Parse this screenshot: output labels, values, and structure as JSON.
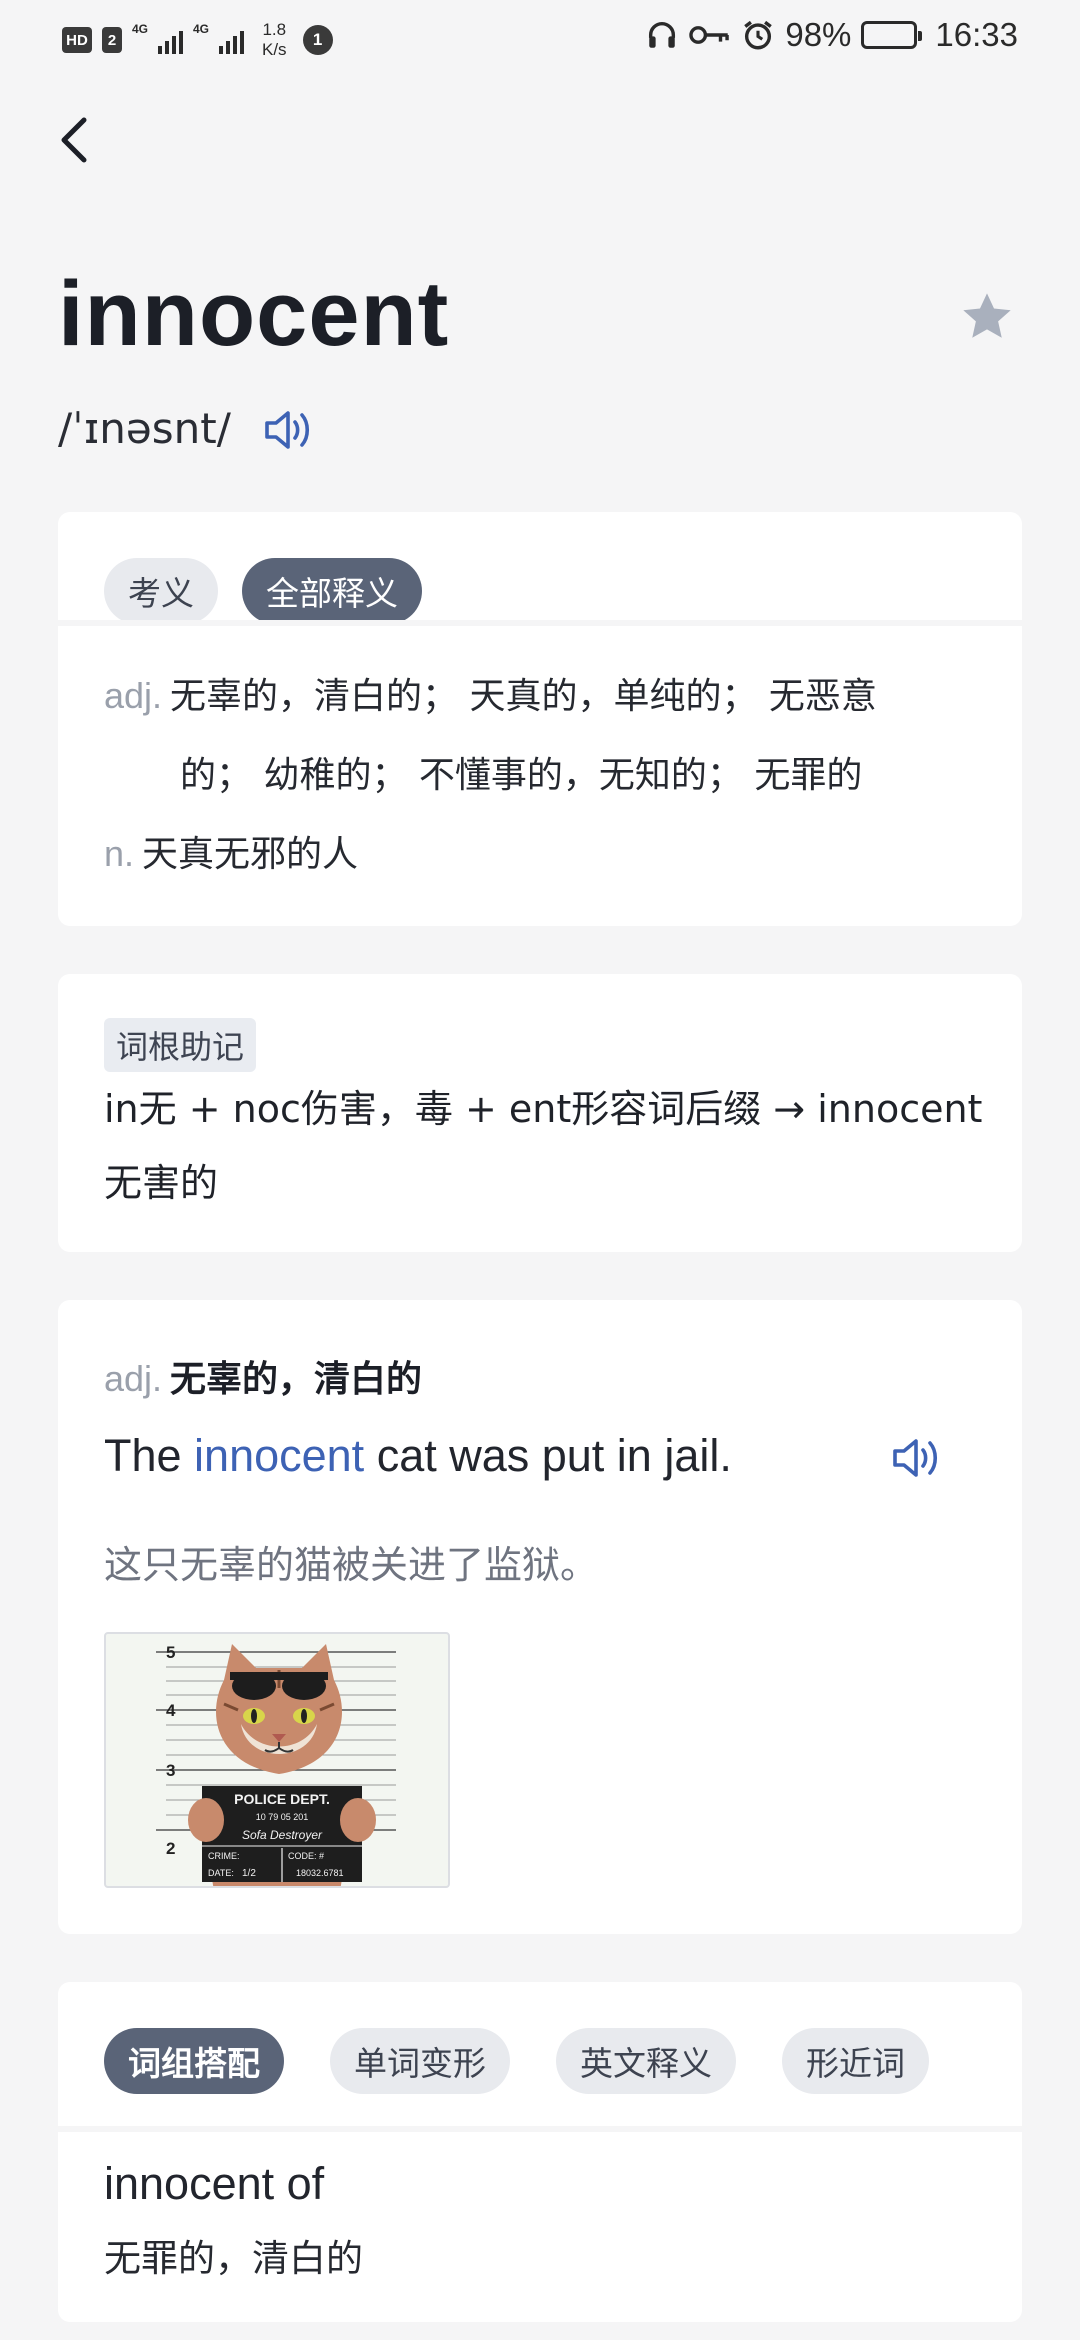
{
  "status_bar": {
    "hd1": "HD",
    "hd2": "2",
    "net1": "4G",
    "net2": "4G",
    "speed_value": "1.8",
    "speed_unit": "K/s",
    "circle_badge": "1",
    "battery": "98%",
    "time": "16:33"
  },
  "word": {
    "headword": "innocent",
    "phonetic": "/ˈɪnəsnt/"
  },
  "definitions": {
    "tabs": [
      "考义",
      "全部释义"
    ],
    "active_tab": 1,
    "adj_pos": "adj.",
    "adj_line1": "无辜的，清白的；  天真的，单纯的；  无恶意",
    "adj_line2": "的；  幼稚的；  不懂事的，无知的；  无罪的",
    "n_pos": "n.",
    "n_line": "天真无邪的人"
  },
  "mnemonic": {
    "tag": "词根助记",
    "line1": "in无 + noc伤害，毒 + ent形容词后缀 → innocent",
    "line2": "无害的"
  },
  "example": {
    "pos": "adj.",
    "meaning": "无辜的，清白的",
    "sentence_before": "The ",
    "sentence_highlight": "innocent",
    "sentence_after": " cat was put in jail.",
    "translation": "这只无辜的猫被关进了监狱。",
    "image": {
      "height_marks": [
        "5",
        "4",
        "3",
        "2"
      ],
      "board_title": "POLICE DEPT.",
      "board_numbers": "10  79  05  201",
      "board_name": "Sofa Destroyer",
      "crime_label": "CRIME:",
      "code_label": "CODE: #",
      "date_label": "DATE:",
      "date_value": "1/2",
      "code_value": "18032.6781"
    }
  },
  "phrases": {
    "tabs": [
      "词组搭配",
      "单词变形",
      "英文释义",
      "形近词"
    ],
    "active_tab": 0,
    "phrase": "innocent of",
    "phrase_meaning": "无罪的，清白的"
  },
  "colors": {
    "accent_blue": "#3d62b4",
    "pill_active": "#5a6478",
    "star_gray": "#a9b0bd"
  }
}
